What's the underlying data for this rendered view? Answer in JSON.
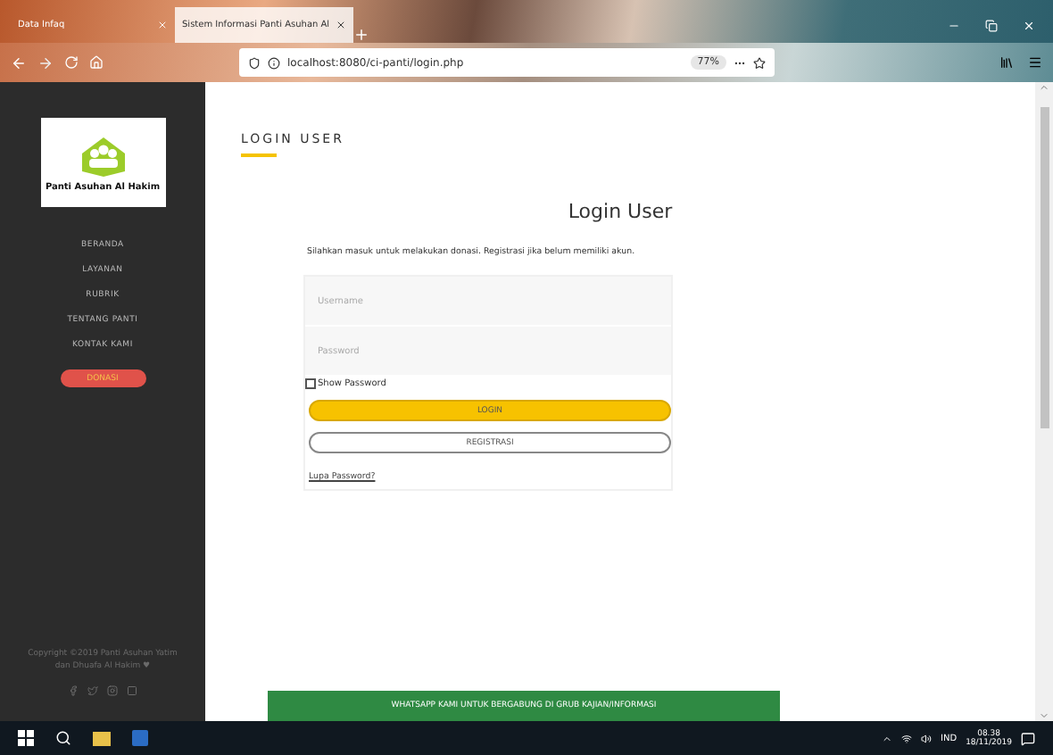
{
  "browser": {
    "tabs": [
      {
        "title": "Data Infaq",
        "selected": false
      },
      {
        "title": "Sistem Informasi Panti Asuhan Al",
        "selected": true
      }
    ],
    "url": "localhost:8080/ci-panti/login.php",
    "zoom": "77%"
  },
  "sidebar": {
    "logo_caption": "Panti Asuhan Al Hakim",
    "menu": [
      {
        "label": "BERANDA"
      },
      {
        "label": "LAYANAN"
      },
      {
        "label": "RUBRIK"
      },
      {
        "label": "TENTANG PANTI"
      },
      {
        "label": "KONTAK KAMI"
      }
    ],
    "donate": "DONASI",
    "copyright": [
      "Copyright ©2019 Panti Asuhan Yatim",
      "dan Dhuafa Al Hakim ♥"
    ]
  },
  "page": {
    "section_title": "LOGIN USER",
    "form_title": "Login User",
    "intro": "Silahkan masuk untuk melakukan donasi. Registrasi jika belum memiliki akun.",
    "username": {
      "placeholder": "Username"
    },
    "password": {
      "placeholder": "Password"
    },
    "show_password": {
      "label": "Show Password",
      "checked": false
    },
    "login": "LOGIN",
    "register": "REGISTRASI",
    "forgot": "Lupa Password?",
    "whatsapp": "WHATSAPP KAMI UNTUK BERGABUNG DI GRUB KAJIAN/INFORMASI"
  },
  "taskbar": {
    "language": "IND",
    "time": "08.38",
    "date": "18/11/2019"
  }
}
